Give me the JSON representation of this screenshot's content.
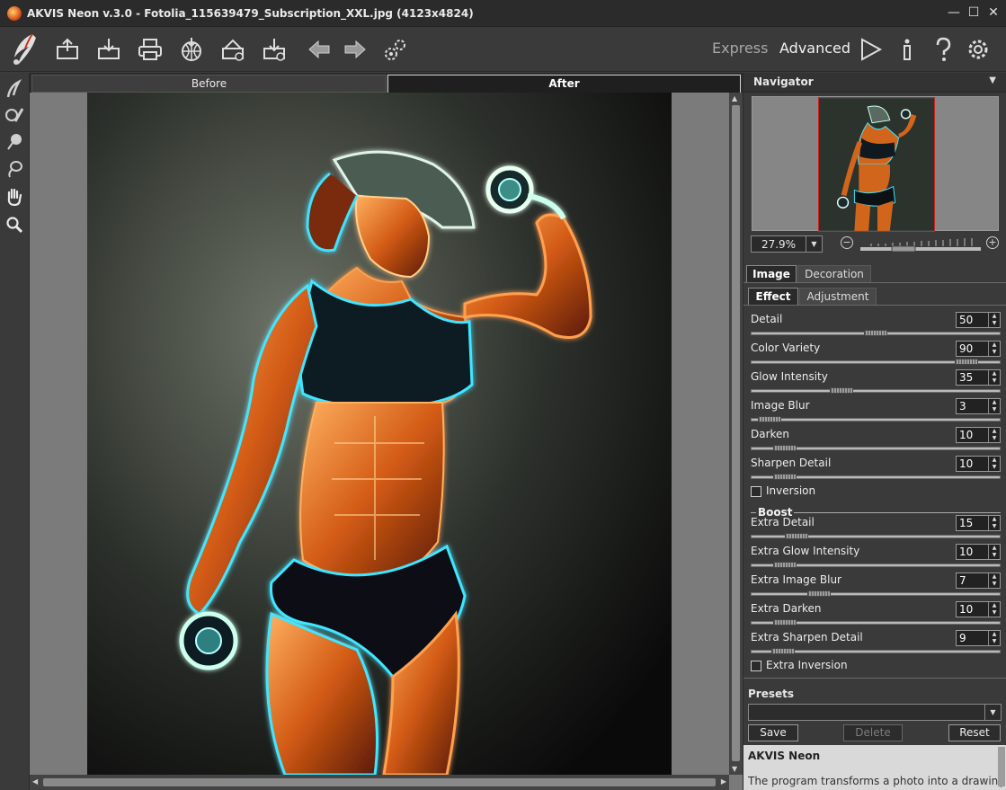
{
  "window": {
    "title": "AKVIS Neon v.3.0 - Fotolia_115639479_Subscription_XXL.jpg (4123x4824)",
    "minimize": "—",
    "maximize": "☐",
    "close": "✕"
  },
  "toolbar": {
    "mode_express": "Express",
    "mode_advanced": "Advanced",
    "icons": [
      "open-icon",
      "save-icon",
      "print-icon",
      "share-icon",
      "batch-icon",
      "plugin-icon",
      "undo-arrow-icon",
      "redo-arrow-icon",
      "preferences-gear-icon",
      "run-icon",
      "info-icon",
      "help-icon",
      "settings-gear-icon"
    ]
  },
  "left_tools": [
    "preprocessing-brush-icon",
    "stroke-brush-icon",
    "eraser-icon",
    "lasso-icon",
    "hand-icon",
    "zoom-icon"
  ],
  "view_tabs": {
    "before": "Before",
    "after": "After"
  },
  "navigator": {
    "title": "Navigator",
    "zoom": "27.9%",
    "zoom_minus": "−",
    "zoom_plus": "+"
  },
  "panel_tabs": {
    "image": "Image",
    "decoration": "Decoration",
    "effect": "Effect",
    "adjustment": "Adjustment"
  },
  "effect_params": [
    {
      "label": "Detail",
      "value": "50",
      "level": 0.5
    },
    {
      "label": "Color Variety",
      "value": "90",
      "level": 0.9
    },
    {
      "label": "Glow Intensity",
      "value": "35",
      "level": 0.35
    },
    {
      "label": "Image Blur",
      "value": "3",
      "level": 0.03
    },
    {
      "label": "Darken",
      "value": "10",
      "level": 0.1
    },
    {
      "label": "Sharpen Detail",
      "value": "10",
      "level": 0.1
    }
  ],
  "inversion_label": "Inversion",
  "boost_label": "Boost",
  "boost_params": [
    {
      "label": "Extra Detail",
      "value": "15",
      "level": 0.15
    },
    {
      "label": "Extra Glow Intensity",
      "value": "10",
      "level": 0.1
    },
    {
      "label": "Extra Image Blur",
      "value": "7",
      "level": 0.25
    },
    {
      "label": "Extra Darken",
      "value": "10",
      "level": 0.1
    },
    {
      "label": "Extra Sharpen Detail",
      "value": "9",
      "level": 0.09
    }
  ],
  "extra_inversion_label": "Extra Inversion",
  "presets": {
    "label": "Presets",
    "selected": "",
    "save": "Save",
    "delete": "Delete",
    "reset": "Reset"
  },
  "help": {
    "title": "AKVIS Neon",
    "text": "The program transforms a photo into a drawing"
  },
  "colors": {
    "accent_glow_orange": "#ff7a1a",
    "accent_glow_cyan": "#3fe6ff",
    "panel_bg": "#3a3a3a"
  }
}
